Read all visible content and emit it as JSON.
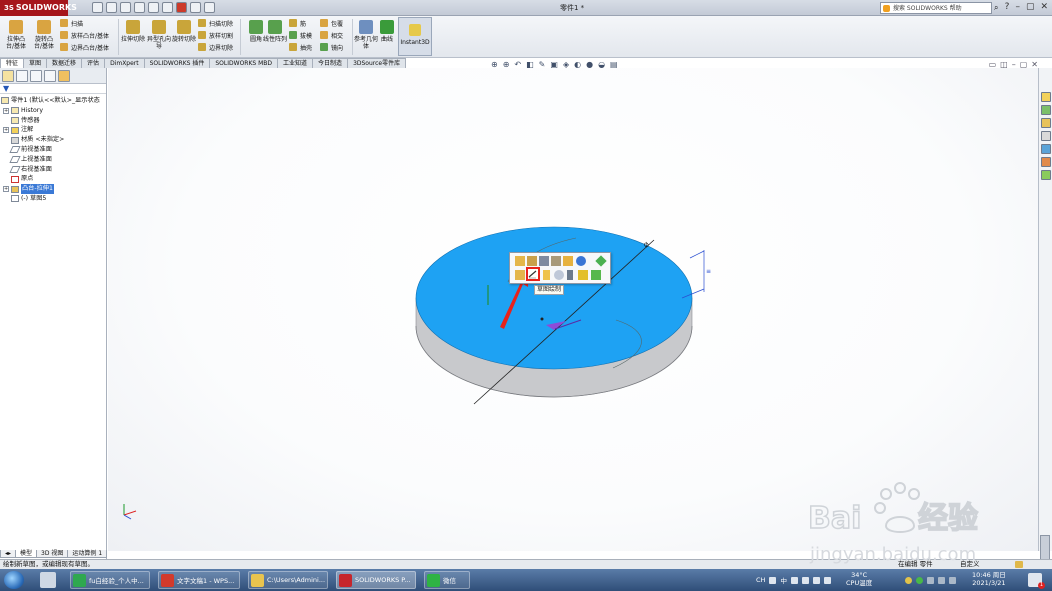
{
  "app": {
    "logo_text": "SOLIDWORKS",
    "logo_prefix": "3S",
    "document_title": "零件1 *"
  },
  "search": {
    "placeholder": "搜索 SOLIDWORKS 帮助"
  },
  "ribbon": {
    "big_buttons": [
      {
        "label": "拉伸凸台/基体",
        "icon": "extrude-boss-icon",
        "color": "#d9a441"
      },
      {
        "label": "旋转凸台/基体",
        "icon": "revolve-boss-icon",
        "color": "#d9a441"
      },
      {
        "label": "拉伸切除",
        "icon": "extrude-cut-icon",
        "color": "#c9a53a"
      },
      {
        "label": "异型孔向导",
        "icon": "hole-wizard-icon",
        "color": "#c9a53a"
      },
      {
        "label": "旋转切除",
        "icon": "revolve-cut-icon",
        "color": "#c9a53a"
      },
      {
        "label": "圆角",
        "icon": "fillet-icon",
        "color": "#58a04d"
      },
      {
        "label": "线性阵列",
        "icon": "linear-pattern-icon",
        "color": "#58a04d"
      },
      {
        "label": "参考几何体",
        "icon": "reference-geometry-icon",
        "color": "#6e8fbf"
      },
      {
        "label": "曲线",
        "icon": "curves-icon",
        "color": "#3a9b3a"
      }
    ],
    "small_buttons": [
      {
        "label": "扫描",
        "icon": "sweep-icon"
      },
      {
        "label": "放样凸台/基体",
        "icon": "loft-boss-icon"
      },
      {
        "label": "边界凸台/基体",
        "icon": "boundary-boss-icon"
      },
      {
        "label": "扫描切除",
        "icon": "swept-cut-icon"
      },
      {
        "label": "放样切割",
        "icon": "lofted-cut-icon"
      },
      {
        "label": "边界切除",
        "icon": "boundary-cut-icon"
      },
      {
        "label": "筋",
        "icon": "rib-icon"
      },
      {
        "label": "拔模",
        "icon": "draft-icon"
      },
      {
        "label": "抽壳",
        "icon": "shell-icon"
      },
      {
        "label": "包覆",
        "icon": "wrap-icon"
      },
      {
        "label": "相交",
        "icon": "intersect-icon"
      },
      {
        "label": "镜向",
        "icon": "mirror-icon"
      }
    ],
    "instant3d": "Instant3D"
  },
  "tabs": [
    "特征",
    "草图",
    "数据迁移",
    "评估",
    "DimXpert",
    "SOLIDWORKS 插件",
    "SOLIDWORKS MBD",
    "工业知道",
    "今日制造",
    "3DSource零件库"
  ],
  "active_tab": "特征",
  "feature_tree": {
    "items": [
      {
        "label": "零件1 (默认<<默认>_显示状态",
        "icon": "part-icon",
        "indent": 0,
        "expand": ""
      },
      {
        "label": "History",
        "icon": "history-icon",
        "indent": 1,
        "expand": "+"
      },
      {
        "label": "传感器",
        "icon": "sensor-icon",
        "indent": 1,
        "expand": ""
      },
      {
        "label": "注解",
        "icon": "annotations-icon",
        "indent": 1,
        "expand": "+"
      },
      {
        "label": "材质 <未指定>",
        "icon": "material-icon",
        "indent": 1,
        "expand": ""
      },
      {
        "label": "前视基准面",
        "icon": "plane-icon",
        "indent": 1,
        "expand": ""
      },
      {
        "label": "上视基准面",
        "icon": "plane-icon",
        "indent": 1,
        "expand": ""
      },
      {
        "label": "右视基准面",
        "icon": "plane-icon",
        "indent": 1,
        "expand": ""
      },
      {
        "label": "原点",
        "icon": "origin-icon",
        "indent": 1,
        "expand": ""
      },
      {
        "label": "凸台-拉伸1",
        "icon": "extrude-feature-icon",
        "indent": 1,
        "expand": "+",
        "selected": true
      },
      {
        "label": "(-) 草图5",
        "icon": "sketch-icon",
        "indent": 1,
        "expand": ""
      }
    ]
  },
  "bottom_tabs": [
    "模型",
    "3D 视图",
    "运动算例 1"
  ],
  "context_toolbar": {
    "tooltip": "草图绘制",
    "highlighted": "sketch-icon"
  },
  "status_bar": {
    "message": "绘制新草图，或编辑现有草图。",
    "mode": "在编辑 零件",
    "unit": "自定义"
  },
  "taskbar": {
    "tasks": [
      {
        "label": "fu白经验_个人中...",
        "icon": "browser-icon",
        "color": "#2fa84f"
      },
      {
        "label": "文字文稿1 - WPS...",
        "icon": "wps-icon",
        "color": "#d33a2c"
      },
      {
        "label": "C:\\Users\\Admini...",
        "icon": "folder-icon",
        "color": "#e9c44e"
      },
      {
        "label": "SOLIDWORKS P...",
        "icon": "solidworks-icon",
        "color": "#c6252b"
      },
      {
        "label": "微信",
        "icon": "wechat-icon",
        "color": "#2fb344"
      }
    ],
    "temperature": "34°C",
    "cpu_label": "CPU温度",
    "time": "10:46 周日",
    "date": "2021/3/21",
    "tray_lang": "CH",
    "tray_ime": "中",
    "notification_count": "1"
  },
  "watermark": {
    "brand": "Baidu经验",
    "url": "jingyan.baidu.com"
  },
  "colors": {
    "part_face": "#1ea2f3",
    "selection_highlight": "#e8221b",
    "arrow": "#e8221b"
  }
}
